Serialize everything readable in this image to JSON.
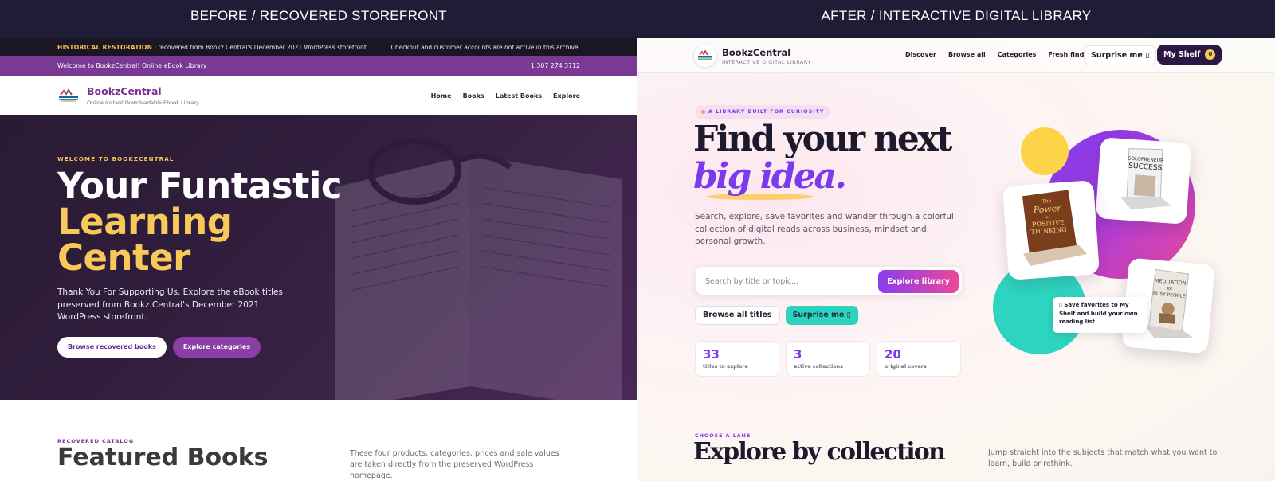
{
  "headers": {
    "left": "BEFORE / RECOVERED STOREFRONT",
    "right": "AFTER / INTERACTIVE DIGITAL LIBRARY"
  },
  "before": {
    "top_bar": {
      "highlight": "HISTORICAL RESTORATION",
      "text": " · recovered from Bookz Central's December 2021 WordPress storefront",
      "notice": "Checkout and customer accounts are not active in this archive."
    },
    "purple_bar": {
      "welcome": "Welcome to BookzCentral! Online eBook Library",
      "phone": "1 307 274 3712"
    },
    "brand": {
      "name": "BookzCentral",
      "tagline": "Online Instant Downloadable Ebook Library"
    },
    "nav": [
      "Home",
      "Books",
      "Latest Books",
      "Explore"
    ],
    "hero": {
      "eyebrow": "WELCOME TO BOOKZCENTRAL",
      "title_line1": "Your Funtastic",
      "title_line2": "Learning",
      "title_line3": "Center",
      "description": "Thank You For Supporting Us. Explore the eBook titles preserved from Bookz Central's December 2021 WordPress storefront.",
      "button_primary": "Browse recovered books",
      "button_secondary": "Explore categories"
    },
    "featured": {
      "eyebrow": "RECOVERED CATALOG",
      "title": "Featured Books",
      "description": "These four products, categories, prices and sale values are taken directly from the preserved WordPress homepage."
    }
  },
  "after": {
    "brand": {
      "name": "BookzCentral",
      "tagline": "INTERACTIVE DIGITAL LIBRARY"
    },
    "nav": [
      "Discover",
      "Browse all",
      "Categories",
      "Fresh finds"
    ],
    "surprise_label": "Surprise me ▯",
    "shelf_label": "My Shelf",
    "shelf_count": "0",
    "hero": {
      "pill": "A LIBRARY BUILT FOR CURIOSITY",
      "title_line1": "Find your next",
      "title_line2": "big idea.",
      "description": "Search, explore, save favorites and wander through a colorful collection of digital reads across business, mindset and personal growth.",
      "search_placeholder": "Search by title or topic...",
      "explore_button": "Explore library",
      "browse_button": "Browse all titles",
      "surprise_button": "Surprise me ▯"
    },
    "stats": [
      {
        "value": "33",
        "label": "titles to explore"
      },
      {
        "value": "3",
        "label": "active collections"
      },
      {
        "value": "20",
        "label": "original covers"
      }
    ],
    "bubble": "▯ Save favorites to My Shelf and build your own reading list.",
    "books": [
      {
        "title_line1": "The",
        "title_line2": "Power",
        "title_line3": "of",
        "title_line4": "POSITIVE",
        "title_line5": "THINKING"
      },
      {
        "title_line1": "SOLOPRENEUR",
        "title_line2": "SUCCESS"
      },
      {
        "title_line1": "MEDITATION",
        "title_line2": "for",
        "title_line3": "BUSY PEOPLE"
      }
    ],
    "collections": {
      "eyebrow": "CHOOSE A LANE",
      "title": "Explore by collection",
      "description": "Jump straight into the subjects that match what you want to learn, build or rethink."
    },
    "colors": {
      "accent": "#7c3aed",
      "pink": "#ec4899",
      "teal": "#2dd4bf",
      "yellow": "#fdd447"
    }
  }
}
